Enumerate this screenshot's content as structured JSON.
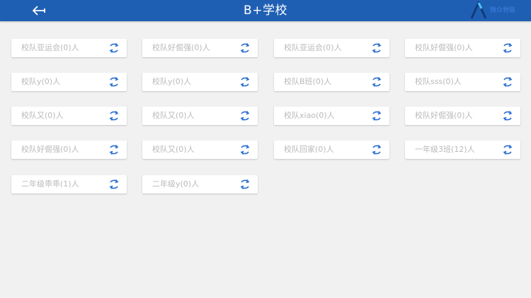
{
  "header": {
    "title": "B+学校",
    "back_icon": "back-arrow-icon",
    "bg_color": "#1f5fb3"
  },
  "logo": {
    "text": "微众物联",
    "color": "#3c7fe0"
  },
  "teams": [
    {
      "label": "校队亚运会(0)人"
    },
    {
      "label": "校队好倔强(0)人"
    },
    {
      "label": "校队亚运会(0)人"
    },
    {
      "label": "校队好倔强(0)人"
    },
    {
      "label": "校队y(0)人"
    },
    {
      "label": "校队y(0)人"
    },
    {
      "label": "校队B班(0)人"
    },
    {
      "label": "校队sss(0)人"
    },
    {
      "label": "校队又(0)人"
    },
    {
      "label": "校队又(0)人"
    },
    {
      "label": "校队xiao(0)人"
    },
    {
      "label": "校队好倔强(0)人"
    },
    {
      "label": "校队好倔强(0)人"
    },
    {
      "label": "校队又(0)人"
    },
    {
      "label": "校队回家(0)人"
    },
    {
      "label": "一年级3班(12)人"
    },
    {
      "label": "二年级乖乖(1)人"
    },
    {
      "label": "二年级y(0)人"
    }
  ],
  "refresh_icon": "refresh-icon",
  "accent_color": "#2a6ed2"
}
